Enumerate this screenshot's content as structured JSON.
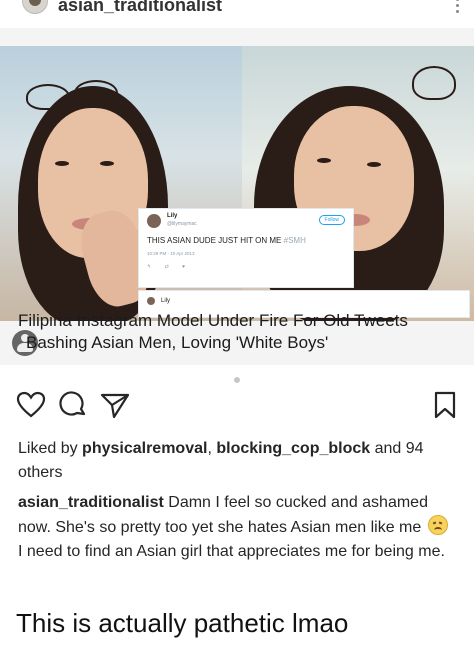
{
  "header": {
    "username": "asian_traditionalist"
  },
  "post_image": {
    "tweet": {
      "name": "Lily",
      "handle": "@lilymaymac",
      "follow_label": "Follow",
      "text": "THIS ASIAN DUDE JUST HIT ON ME",
      "hashtag": "#SMH",
      "meta": "10:29 PM - 10 Apr 2013",
      "actions": "↰ ⇄ ♥"
    },
    "reply": {
      "name": "Lily"
    },
    "headline_line1": "Filipina Instagram Model Under Fire For Old Tweets",
    "headline_line2": "Bashing Asian Men, Loving 'White Boys'"
  },
  "likes": {
    "prefix": "Liked by ",
    "user1": "physicalremoval",
    "separator": ", ",
    "user2": "blocking_cop_block",
    "suffix": " and 94 others"
  },
  "caption": {
    "username": "asian_traditionalist",
    "text_part1": " Damn I feel so cucked and ashamed now. She's so pretty too yet she hates Asian men like me ",
    "emoji": "persevering-face",
    "text_part2": " I need to find an Asian girl that appreciates me for being me."
  },
  "comment_text": "This is actually pathetic lmao",
  "colors": {
    "text": "#262626",
    "twitter_blue": "#1da1f2",
    "icon_stroke": "#262626"
  },
  "icons": [
    "heart-icon",
    "comment-icon",
    "share-icon",
    "bookmark-icon",
    "more-icon"
  ]
}
